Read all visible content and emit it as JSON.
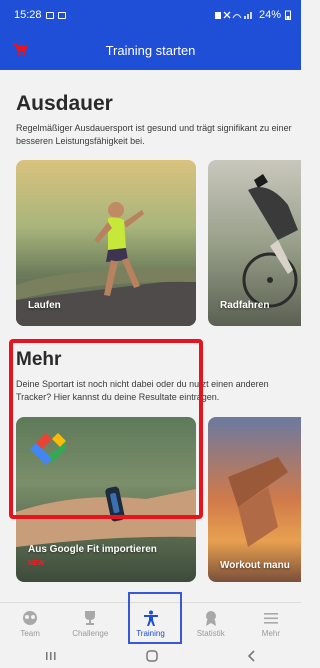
{
  "status_bar": {
    "time": "15:28",
    "battery": "24%"
  },
  "appbar": {
    "title": "Training starten"
  },
  "sections": {
    "endurance": {
      "title": "Ausdauer",
      "description": "Regelmäßiger Ausdauersport ist gesund und trägt signifikant zu einer besseren Leistungsfähigkeit bei.",
      "cards": [
        {
          "label": "Laufen"
        },
        {
          "label": "Radfahren"
        }
      ]
    },
    "more": {
      "title": "Mehr",
      "description": "Deine Sportart ist noch nicht dabei oder du nutzt einen anderen Tracker? Hier kannst du deine Resultate eintragen.",
      "cards": [
        {
          "label": "Aus Google Fit importieren",
          "badge": "NEW"
        },
        {
          "label": "Workout manu"
        }
      ]
    }
  },
  "bottom_nav": {
    "items": [
      {
        "label": "Team",
        "icon": "team-icon"
      },
      {
        "label": "Challenge",
        "icon": "trophy-icon"
      },
      {
        "label": "Training",
        "icon": "person-icon",
        "active": true
      },
      {
        "label": "Statistik",
        "icon": "award-icon"
      },
      {
        "label": "Mehr",
        "icon": "menu-icon"
      }
    ]
  },
  "colors": {
    "primary": "#1e4fd6",
    "highlight_red": "#e8141d",
    "badge_red": "#e8202a"
  }
}
